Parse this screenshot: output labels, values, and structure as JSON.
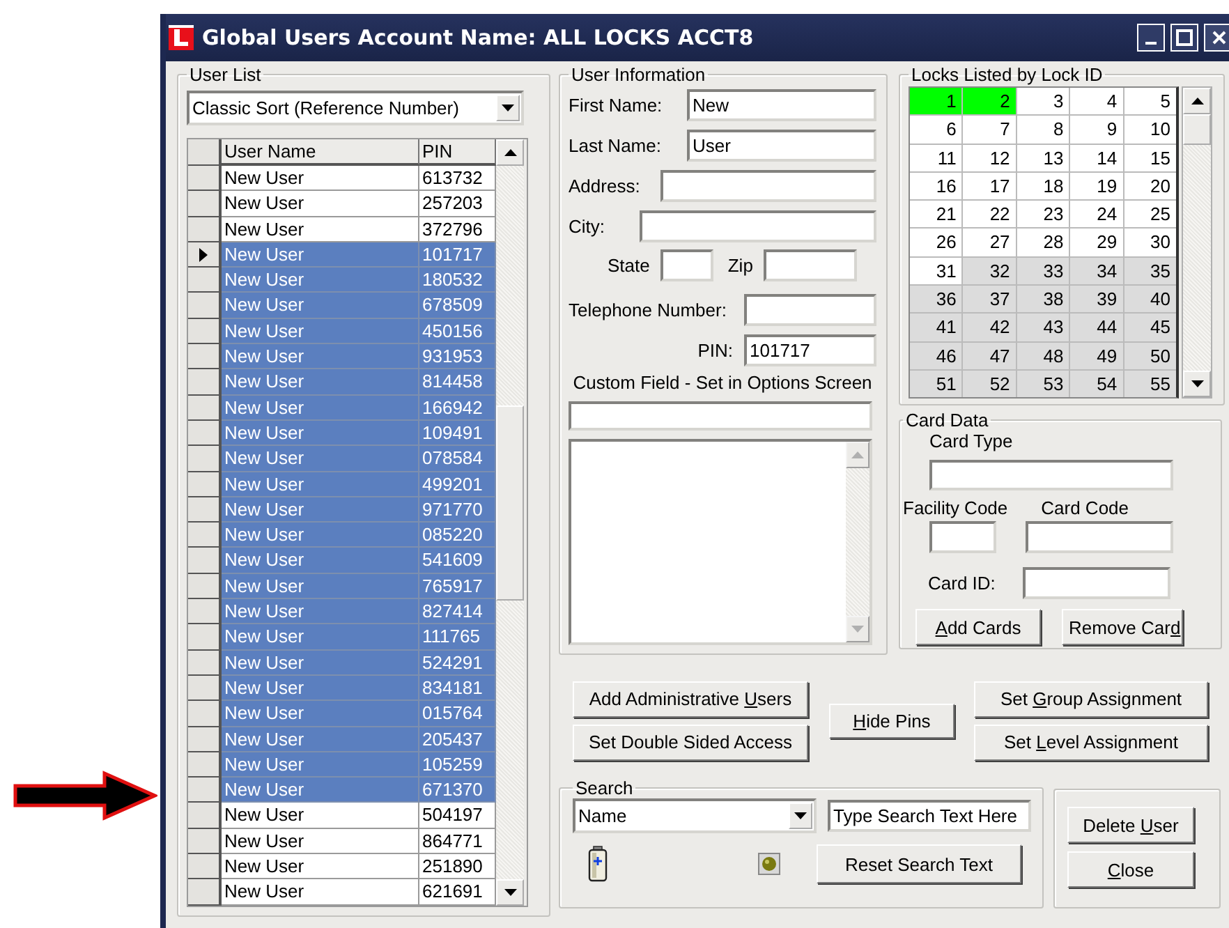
{
  "window": {
    "title": "Global Users Account Name: ALL LOCKS ACCT8"
  },
  "user_list": {
    "label": "User List",
    "sort": "Classic Sort (Reference Number)",
    "columns": [
      "User Name",
      "PIN"
    ],
    "rows": [
      {
        "name": "New User",
        "pin": "613732",
        "selected": false,
        "current": false
      },
      {
        "name": "New User",
        "pin": "257203",
        "selected": false,
        "current": false
      },
      {
        "name": "New User",
        "pin": "372796",
        "selected": false,
        "current": false
      },
      {
        "name": "New User",
        "pin": "101717",
        "selected": true,
        "current": true
      },
      {
        "name": "New User",
        "pin": "180532",
        "selected": true,
        "current": false
      },
      {
        "name": "New User",
        "pin": "678509",
        "selected": true,
        "current": false
      },
      {
        "name": "New User",
        "pin": "450156",
        "selected": true,
        "current": false
      },
      {
        "name": "New User",
        "pin": "931953",
        "selected": true,
        "current": false
      },
      {
        "name": "New User",
        "pin": "814458",
        "selected": true,
        "current": false
      },
      {
        "name": "New User",
        "pin": "166942",
        "selected": true,
        "current": false
      },
      {
        "name": "New User",
        "pin": "109491",
        "selected": true,
        "current": false
      },
      {
        "name": "New User",
        "pin": "078584",
        "selected": true,
        "current": false
      },
      {
        "name": "New User",
        "pin": "499201",
        "selected": true,
        "current": false
      },
      {
        "name": "New User",
        "pin": "971770",
        "selected": true,
        "current": false
      },
      {
        "name": "New User",
        "pin": "085220",
        "selected": true,
        "current": false
      },
      {
        "name": "New User",
        "pin": "541609",
        "selected": true,
        "current": false
      },
      {
        "name": "New User",
        "pin": "765917",
        "selected": true,
        "current": false
      },
      {
        "name": "New User",
        "pin": "827414",
        "selected": true,
        "current": false
      },
      {
        "name": "New User",
        "pin": "111765",
        "selected": true,
        "current": false
      },
      {
        "name": "New User",
        "pin": "524291",
        "selected": true,
        "current": false
      },
      {
        "name": "New User",
        "pin": "834181",
        "selected": true,
        "current": false
      },
      {
        "name": "New User",
        "pin": "015764",
        "selected": true,
        "current": false
      },
      {
        "name": "New User",
        "pin": "205437",
        "selected": true,
        "current": false
      },
      {
        "name": "New User",
        "pin": "105259",
        "selected": true,
        "current": false
      },
      {
        "name": "New User",
        "pin": "671370",
        "selected": true,
        "current": false
      },
      {
        "name": "New User",
        "pin": "504197",
        "selected": false,
        "current": false
      },
      {
        "name": "New User",
        "pin": "864771",
        "selected": false,
        "current": false
      },
      {
        "name": "New User",
        "pin": "251890",
        "selected": false,
        "current": false
      },
      {
        "name": "New User",
        "pin": "621691",
        "selected": false,
        "current": false
      }
    ]
  },
  "user_information": {
    "label": "User Information",
    "first_name": {
      "label": "First Name:",
      "value": "New"
    },
    "last_name": {
      "label": "Last Name:",
      "value": "User"
    },
    "address": {
      "label": "Address:"
    },
    "city": {
      "label": "City:"
    },
    "state": {
      "label": "State"
    },
    "zip": {
      "label": "Zip"
    },
    "telephone": {
      "label": "Telephone Number:"
    },
    "pin": {
      "label": "PIN:",
      "value": "101717"
    },
    "custom_field": {
      "label": "Custom Field - Set in Options Screen"
    }
  },
  "locks": {
    "label": "Locks Listed by Lock ID",
    "cells": [
      {
        "number": "1",
        "color": "#00ff00"
      },
      {
        "number": "2",
        "color": "#00ff00"
      },
      {
        "number": "3",
        "color": "#ffffff"
      },
      {
        "number": "4",
        "color": "#ffffff"
      },
      {
        "number": "5",
        "color": "#ffffff"
      },
      {
        "number": "6",
        "color": "#ffffff"
      },
      {
        "number": "7",
        "color": "#ffffff"
      },
      {
        "number": "8",
        "color": "#ffffff"
      },
      {
        "number": "9",
        "color": "#ffffff"
      },
      {
        "number": "10",
        "color": "#ffffff"
      },
      {
        "number": "11",
        "color": "#ffffff"
      },
      {
        "number": "12",
        "color": "#ffffff"
      },
      {
        "number": "13",
        "color": "#ffffff"
      },
      {
        "number": "14",
        "color": "#ffffff"
      },
      {
        "number": "15",
        "color": "#ffffff"
      },
      {
        "number": "16",
        "color": "#ffffff"
      },
      {
        "number": "17",
        "color": "#ffffff"
      },
      {
        "number": "18",
        "color": "#ffffff"
      },
      {
        "number": "19",
        "color": "#ffffff"
      },
      {
        "number": "20",
        "color": "#ffffff"
      },
      {
        "number": "21",
        "color": "#ffffff"
      },
      {
        "number": "22",
        "color": "#ffffff"
      },
      {
        "number": "23",
        "color": "#ffffff"
      },
      {
        "number": "24",
        "color": "#ffffff"
      },
      {
        "number": "25",
        "color": "#ffffff"
      },
      {
        "number": "26",
        "color": "#ffffff"
      },
      {
        "number": "27",
        "color": "#ffffff"
      },
      {
        "number": "28",
        "color": "#ffffff"
      },
      {
        "number": "29",
        "color": "#ffffff"
      },
      {
        "number": "30",
        "color": "#ffffff"
      },
      {
        "number": "31",
        "color": "#ffffff"
      },
      {
        "number": "32",
        "color": "#dcdcdc"
      },
      {
        "number": "33",
        "color": "#dcdcdc"
      },
      {
        "number": "34",
        "color": "#dcdcdc"
      },
      {
        "number": "35",
        "color": "#dcdcdc"
      },
      {
        "number": "36",
        "color": "#dcdcdc"
      },
      {
        "number": "37",
        "color": "#dcdcdc"
      },
      {
        "number": "38",
        "color": "#dcdcdc"
      },
      {
        "number": "39",
        "color": "#dcdcdc"
      },
      {
        "number": "40",
        "color": "#dcdcdc"
      },
      {
        "number": "41",
        "color": "#dcdcdc"
      },
      {
        "number": "42",
        "color": "#dcdcdc"
      },
      {
        "number": "43",
        "color": "#dcdcdc"
      },
      {
        "number": "44",
        "color": "#dcdcdc"
      },
      {
        "number": "45",
        "color": "#dcdcdc"
      },
      {
        "number": "46",
        "color": "#dcdcdc"
      },
      {
        "number": "47",
        "color": "#dcdcdc"
      },
      {
        "number": "48",
        "color": "#dcdcdc"
      },
      {
        "number": "49",
        "color": "#dcdcdc"
      },
      {
        "number": "50",
        "color": "#dcdcdc"
      },
      {
        "number": "51",
        "color": "#dcdcdc"
      },
      {
        "number": "52",
        "color": "#dcdcdc"
      },
      {
        "number": "53",
        "color": "#dcdcdc"
      },
      {
        "number": "54",
        "color": "#dcdcdc"
      },
      {
        "number": "55",
        "color": "#dcdcdc"
      }
    ]
  },
  "card_data": {
    "label": "Card Data",
    "card_type": {
      "label": "Card Type"
    },
    "facility_code": {
      "label": "Facility Code"
    },
    "card_code": {
      "label": "Card Code"
    },
    "card_id": {
      "label": "Card ID:"
    },
    "buttons": [
      {
        "label": {
          "key": "A",
          "after": "dd Cards"
        }
      },
      {
        "label": {
          "before": "Remove Car",
          "key": "d"
        }
      }
    ]
  },
  "actions": [
    {
      "label": {
        "before": "Add Administrative ",
        "key": "U",
        "after": "sers"
      }
    },
    {
      "label": {
        "before": "Set Double Sided Access"
      }
    },
    {
      "label": {
        "key": "H",
        "after": "ide Pins"
      }
    },
    {
      "label": {
        "before": "Set ",
        "key": "G",
        "after": "roup Assignment"
      }
    },
    {
      "label": {
        "before": "Set ",
        "key": "L",
        "after": "evel Assignment"
      }
    }
  ],
  "search": {
    "label": "Search",
    "field": "Name",
    "text": "Type Search Text Here",
    "reset": {
      "label": {
        "before": "Reset Search Text"
      }
    }
  },
  "user_buttons": [
    {
      "label": {
        "before": "Delete ",
        "key": "U",
        "after": "ser"
      }
    },
    {
      "label": {
        "key": "C",
        "after": "lose"
      }
    }
  ]
}
